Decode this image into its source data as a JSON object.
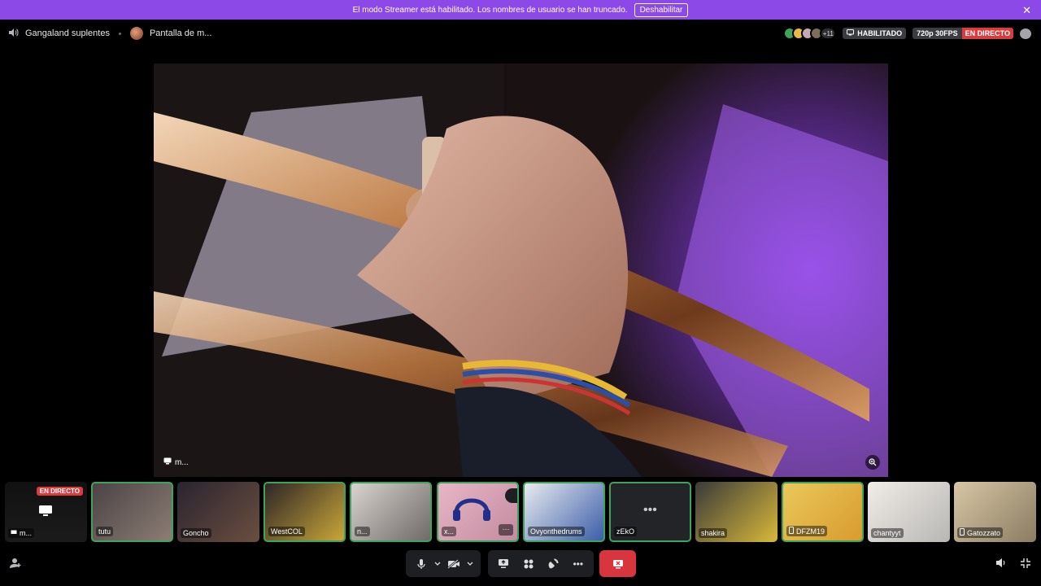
{
  "banner": {
    "message": "El modo Streamer está habilitado. Los nombres de usuario se han truncado.",
    "button_label": "Deshabilitar"
  },
  "header": {
    "channel_name": "Gangaland suplentes",
    "stream_title": "Pantalla de m...",
    "extra_viewers": "+11",
    "streamer_mode_label": "HABILITADO",
    "quality_label": "720p 30FPS",
    "live_label": "EN DIRECTO"
  },
  "stage": {
    "label": "m..."
  },
  "tiles": [
    {
      "name": "m...",
      "live_badge": "EN DIRECTO"
    },
    {
      "name": "tutu"
    },
    {
      "name": "Goncho"
    },
    {
      "name": "WestCOL"
    },
    {
      "name": "n..."
    },
    {
      "name": "x..."
    },
    {
      "name": "Ovyonthedrums"
    },
    {
      "name": "zEkO"
    },
    {
      "name": "shakira"
    },
    {
      "name": "DFZM19"
    },
    {
      "name": "chantyyt"
    },
    {
      "name": "Gatozzato"
    }
  ],
  "colors": {
    "banner": "#8d49e8",
    "live": "#d83c3e",
    "speaking": "#3ba55c",
    "leave": "#d9353e",
    "control_bg": "#1e1f22"
  },
  "icons": [
    "speaker-icon",
    "close-icon",
    "chat-icon",
    "monitor-icon",
    "zoom-icon",
    "mic-icon",
    "camera-off-icon",
    "screen-share-icon",
    "activities-icon",
    "soundboard-icon",
    "more-icon",
    "leave-call-icon",
    "add-user-icon",
    "volume-icon",
    "minimize-icon"
  ]
}
